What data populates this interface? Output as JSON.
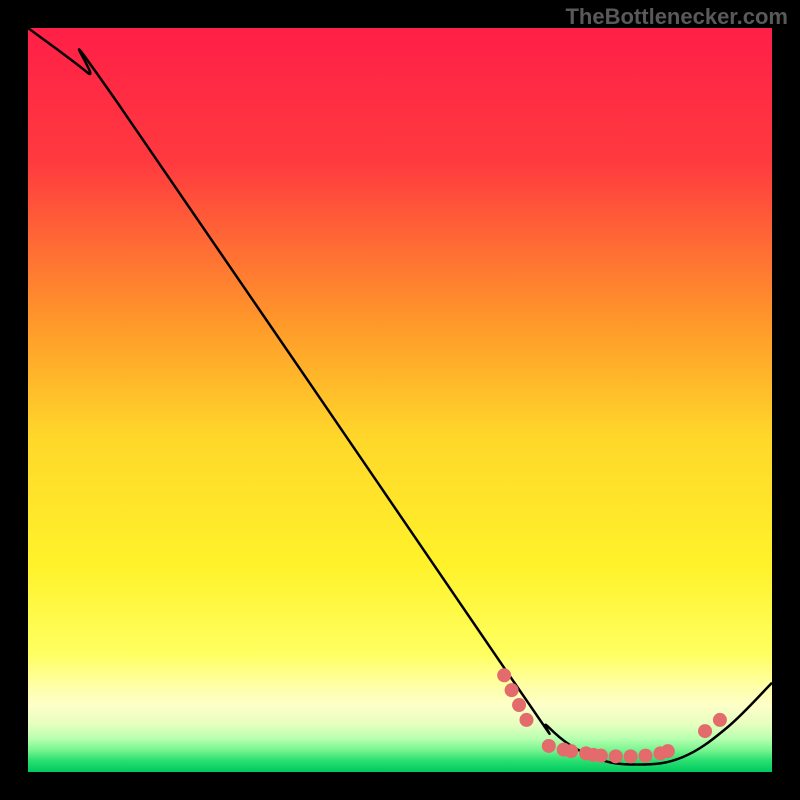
{
  "watermark": "TheBottlenecker.com",
  "chart_data": {
    "type": "line",
    "title": "",
    "xlabel": "",
    "ylabel": "",
    "xlim": [
      0,
      100
    ],
    "ylim": [
      0,
      100
    ],
    "grid": false,
    "series": [
      {
        "name": "curve",
        "color": "#000000",
        "points": [
          {
            "x": 0,
            "y": 100
          },
          {
            "x": 8,
            "y": 94
          },
          {
            "x": 12,
            "y": 90
          },
          {
            "x": 64,
            "y": 14
          },
          {
            "x": 70,
            "y": 6
          },
          {
            "x": 76,
            "y": 2
          },
          {
            "x": 82,
            "y": 1
          },
          {
            "x": 88,
            "y": 2
          },
          {
            "x": 94,
            "y": 6
          },
          {
            "x": 100,
            "y": 12
          }
        ]
      }
    ],
    "markers": {
      "color": "#e46b6b",
      "points": [
        {
          "x": 64,
          "y": 13
        },
        {
          "x": 65,
          "y": 11
        },
        {
          "x": 66,
          "y": 9
        },
        {
          "x": 67,
          "y": 7
        },
        {
          "x": 70,
          "y": 3.5
        },
        {
          "x": 72,
          "y": 3
        },
        {
          "x": 73,
          "y": 2.8
        },
        {
          "x": 75,
          "y": 2.5
        },
        {
          "x": 76,
          "y": 2.3
        },
        {
          "x": 77,
          "y": 2.2
        },
        {
          "x": 79,
          "y": 2.1
        },
        {
          "x": 81,
          "y": 2.1
        },
        {
          "x": 83,
          "y": 2.2
        },
        {
          "x": 85,
          "y": 2.5
        },
        {
          "x": 86,
          "y": 2.8
        },
        {
          "x": 91,
          "y": 5.5
        },
        {
          "x": 93,
          "y": 7
        }
      ]
    },
    "gradient_stops": [
      {
        "offset": 0,
        "color": "#ff1f47"
      },
      {
        "offset": 0.18,
        "color": "#ff3a3f"
      },
      {
        "offset": 0.4,
        "color": "#ff9a2a"
      },
      {
        "offset": 0.55,
        "color": "#ffd72a"
      },
      {
        "offset": 0.72,
        "color": "#fff22a"
      },
      {
        "offset": 0.84,
        "color": "#ffff60"
      },
      {
        "offset": 0.88,
        "color": "#ffffa0"
      },
      {
        "offset": 0.91,
        "color": "#fdffc8"
      },
      {
        "offset": 0.935,
        "color": "#e8ffc0"
      },
      {
        "offset": 0.955,
        "color": "#b8ffb0"
      },
      {
        "offset": 0.97,
        "color": "#7af590"
      },
      {
        "offset": 0.985,
        "color": "#28e070"
      },
      {
        "offset": 1.0,
        "color": "#00c95f"
      }
    ]
  }
}
